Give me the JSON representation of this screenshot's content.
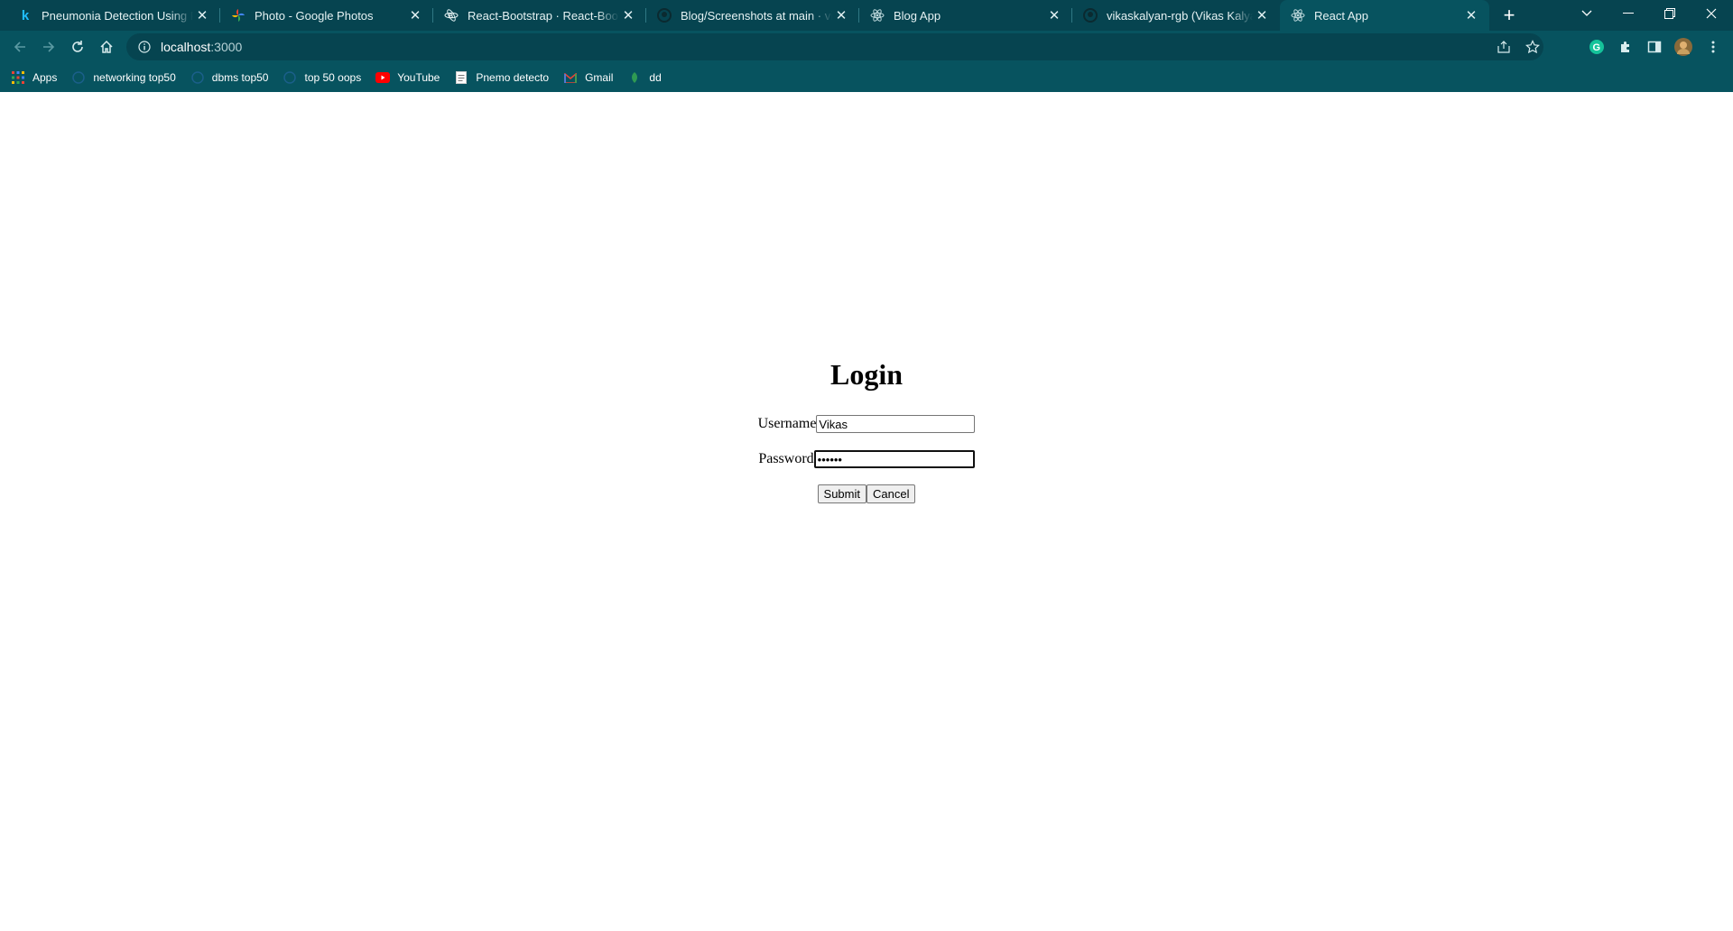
{
  "tabs": [
    {
      "title": "Pneumonia Detection Using Fast",
      "icon": "kaggle-icon"
    },
    {
      "title": "Photo - Google Photos",
      "icon": "google-photos-icon"
    },
    {
      "title": "React-Bootstrap · React-Bootstrap",
      "icon": "react-bootstrap-icon"
    },
    {
      "title": "Blog/Screenshots at main · vikaskalyan",
      "icon": "github-icon"
    },
    {
      "title": "Blog App",
      "icon": "react-icon"
    },
    {
      "title": "vikaskalyan-rgb (Vikas Kalyan)",
      "icon": "github-icon"
    },
    {
      "title": "React App",
      "icon": "react-icon"
    }
  ],
  "address": {
    "host": "localhost",
    "port": ":3000"
  },
  "bookmarks": [
    {
      "label": "Apps",
      "icon": "apps-grid-icon"
    },
    {
      "label": "networking top50",
      "icon": "bookmark-page-icon"
    },
    {
      "label": "dbms top50",
      "icon": "bookmark-page-icon"
    },
    {
      "label": "top 50 oops",
      "icon": "bookmark-page-icon"
    },
    {
      "label": "YouTube",
      "icon": "youtube-icon"
    },
    {
      "label": "Pnemo detecto",
      "icon": "document-icon"
    },
    {
      "label": "Gmail",
      "icon": "gmail-icon"
    },
    {
      "label": "dd",
      "icon": "leaf-icon"
    }
  ],
  "login": {
    "title": "Login",
    "username_label": "Username",
    "username_value": "Vikas",
    "password_label": "Password",
    "password_value": "••••••",
    "submit_label": "Submit",
    "cancel_label": "Cancel"
  },
  "colors": {
    "chrome": "#07535f",
    "tabstrip": "#064450"
  }
}
